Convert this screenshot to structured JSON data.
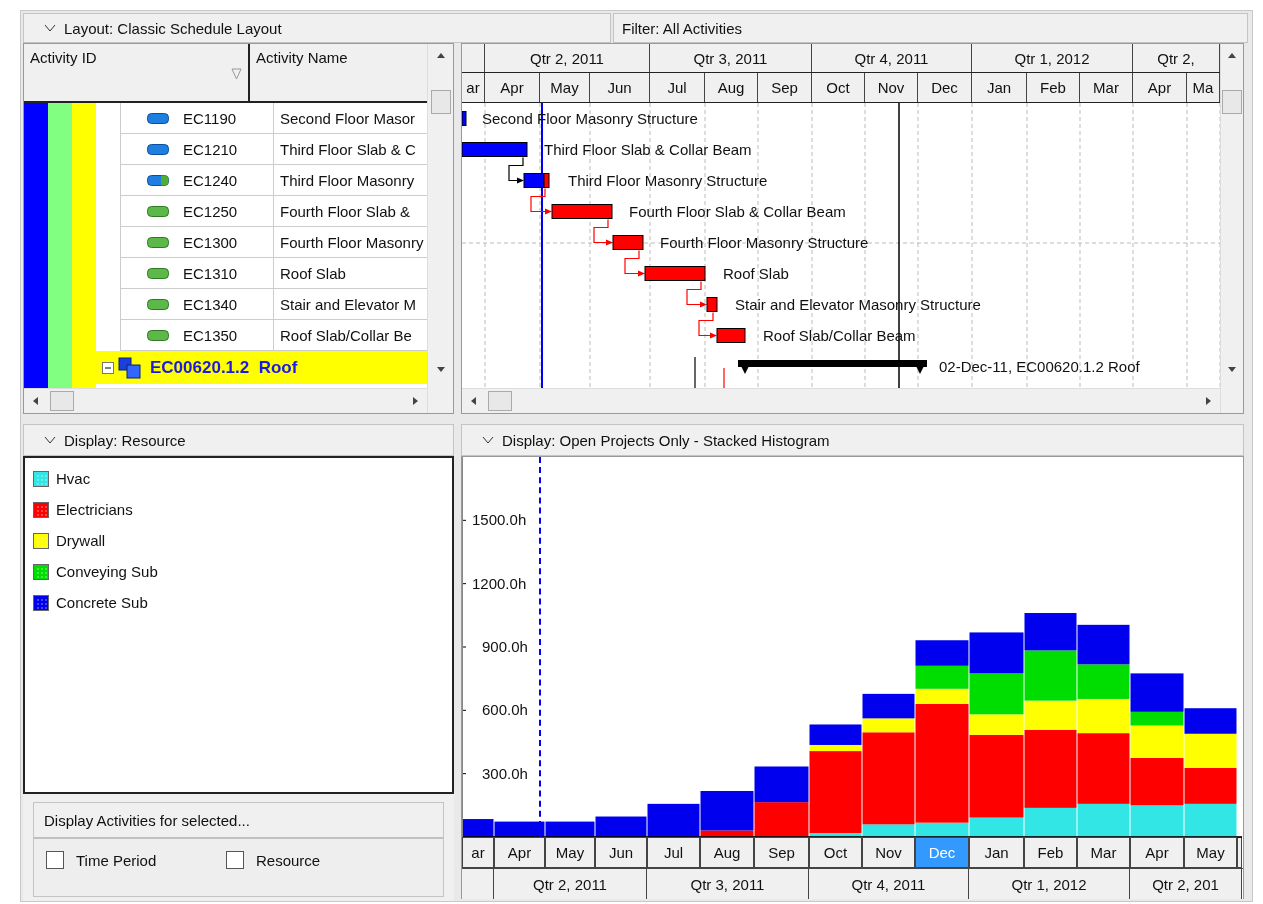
{
  "layout_bar": {
    "title": "Layout: Classic Schedule Layout",
    "filter": "Filter: All Activities"
  },
  "activity_table": {
    "columns": [
      "Activity ID",
      "Activity Name"
    ],
    "rows": [
      {
        "id": "EC1190",
        "name": "Second Floor Masor",
        "kind": "completed",
        "bar_label": "Second Floor Masonry Structure"
      },
      {
        "id": "EC1210",
        "name": "Third Floor Slab & C",
        "kind": "completed",
        "bar_label": "Third Floor Slab & Collar Beam"
      },
      {
        "id": "EC1240",
        "name": "Third Floor Masonry",
        "kind": "in_progress",
        "bar_label": "Third Floor Masonry Structure"
      },
      {
        "id": "EC1250",
        "name": "Fourth Floor Slab &",
        "kind": "not_started",
        "bar_label": "Fourth Floor Slab & Collar Beam"
      },
      {
        "id": "EC1300",
        "name": "Fourth Floor Masonry",
        "kind": "not_started",
        "bar_label": "Fourth Floor Masonry Structure"
      },
      {
        "id": "EC1310",
        "name": "Roof Slab",
        "kind": "not_started",
        "bar_label": "Roof Slab"
      },
      {
        "id": "EC1340",
        "name": "Stair and Elevator M",
        "kind": "not_started",
        "bar_label": "Stair and Elevator Masonry Structure"
      },
      {
        "id": "EC1350",
        "name": "Roof Slab/Collar Be",
        "kind": "not_started",
        "bar_label": "Roof Slab/Collar Beam"
      }
    ],
    "wbs_row": {
      "label": "EC00620.1.2  Roof",
      "expanded": true,
      "bar_label": "02-Dec-11, EC00620.1.2  Roof"
    }
  },
  "gantt": {
    "quarters": [
      "Qtr 2, 2011",
      "Qtr 3, 2011",
      "Qtr 4, 2011",
      "Qtr 1, 2012",
      "Qtr 2,"
    ],
    "months": [
      "ar",
      "Apr",
      "May",
      "Jun",
      "Jul",
      "Aug",
      "Sep",
      "Oct",
      "Nov",
      "Dec",
      "Jan",
      "Feb",
      "Mar",
      "Apr",
      "Ma"
    ]
  },
  "resource_panel": {
    "title": "Display: Resource",
    "group_title": "Display Activities for selected...",
    "options": [
      {
        "label": "Time Period",
        "checked": false
      },
      {
        "label": "Resource",
        "checked": false
      }
    ]
  },
  "histogram": {
    "title": "Display: Open Projects Only - Stacked Histogram",
    "quarters": [
      "Qtr 2, 2011",
      "Qtr 3, 2011",
      "Qtr 4, 2011",
      "Qtr 1, 2012",
      "Qtr 2, 201"
    ],
    "month_cells": [
      {
        "selected": false
      },
      {
        "selected": false
      },
      {
        "selected": false
      },
      {
        "selected": false
      },
      {
        "selected": false
      },
      {
        "selected": false
      },
      {
        "selected": false
      },
      {
        "selected": false
      },
      {
        "selected": false
      },
      {
        "selected": true
      },
      {
        "selected": false
      },
      {
        "selected": false
      },
      {
        "selected": false
      },
      {
        "selected": false
      },
      {
        "selected": false
      }
    ],
    "chart_data": {
      "type": "bar",
      "stacked": true,
      "ylim": [
        0,
        1800
      ],
      "categories": [
        "ar",
        "Apr",
        "May",
        "Jun",
        "Jul",
        "Aug",
        "Sep",
        "Oct",
        "Nov",
        "Dec",
        "Jan",
        "Feb",
        "Mar",
        "Apr",
        "May"
      ],
      "yticks": [
        {
          "value": 300,
          "label": "300.0h"
        },
        {
          "value": 600,
          "label": "600.0h"
        },
        {
          "value": 900,
          "label": "900.0h"
        },
        {
          "value": 1200,
          "label": "1200.0h"
        },
        {
          "value": 1500,
          "label": "1500.0h"
        }
      ],
      "series": [
        {
          "name": "Hvac",
          "color": "#33e6e6",
          "values": [
            0,
            0,
            0,
            0,
            0,
            0,
            0,
            19,
            60,
            68,
            92,
            138,
            157,
            150,
            157
          ]
        },
        {
          "name": "Electricians",
          "color": "#ff0000",
          "values": [
            0,
            0,
            0,
            0,
            0,
            31,
            165,
            388,
            436,
            562,
            392,
            370,
            335,
            225,
            170
          ]
        },
        {
          "name": "Drywall",
          "color": "#ffff00",
          "values": [
            0,
            0,
            0,
            0,
            0,
            0,
            0,
            29,
            66,
            72,
            97,
            138,
            162,
            153,
            162
          ]
        },
        {
          "name": "Conveying Sub",
          "color": "#00dd00",
          "values": [
            0,
            0,
            0,
            0,
            0,
            0,
            0,
            0,
            0,
            109,
            194,
            238,
            164,
            65,
            0
          ]
        },
        {
          "name": "Concrete Sub",
          "color": "#0000ee",
          "values": [
            85,
            73,
            73,
            97,
            157,
            187,
            169,
            97,
            116,
            121,
            194,
            177,
            187,
            182,
            121
          ]
        }
      ]
    }
  }
}
